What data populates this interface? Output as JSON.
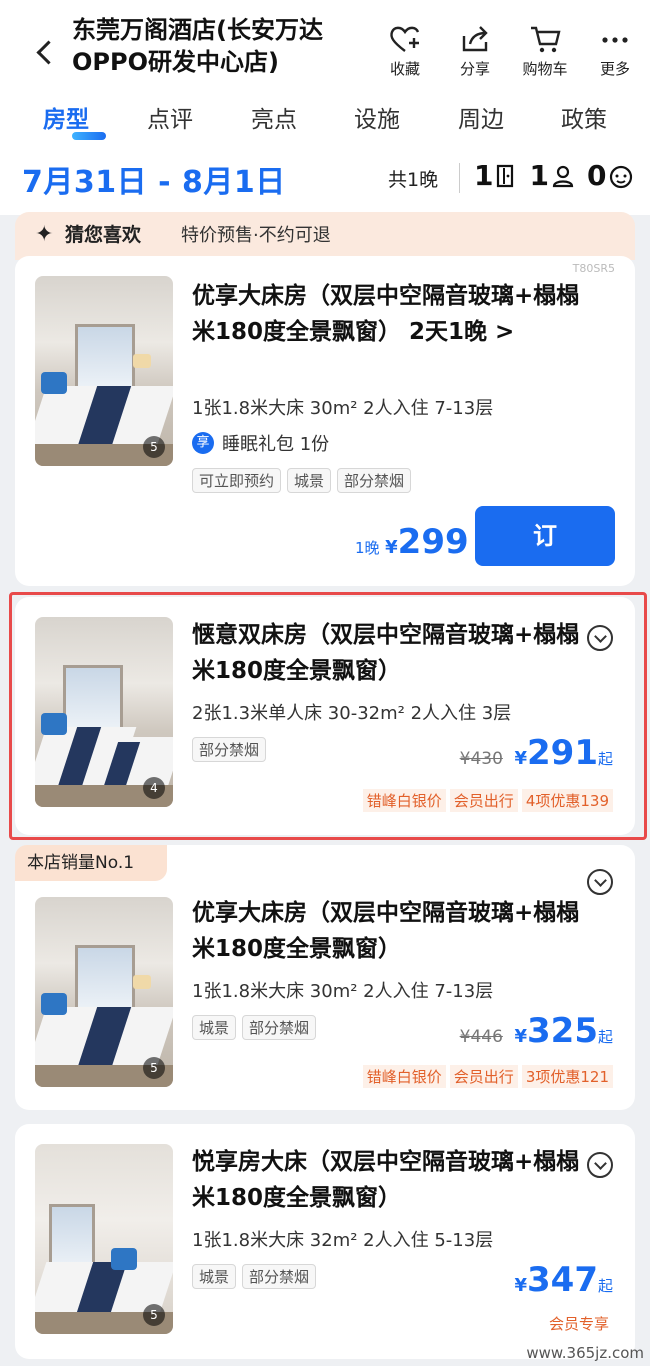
{
  "header": {
    "hotel_name": "东莞万阁酒店(长安万达OPPO研发中心店)",
    "actions": [
      {
        "label": "收藏",
        "icon": "heart-plus-icon"
      },
      {
        "label": "分享",
        "icon": "share-icon"
      },
      {
        "label": "购物车",
        "icon": "cart-icon"
      },
      {
        "label": "更多",
        "icon": "more-icon"
      }
    ]
  },
  "tabs": [
    "房型",
    "点评",
    "亮点",
    "设施",
    "周边",
    "政策"
  ],
  "active_tab": "房型",
  "dates": {
    "range": "7月31日 - 8月1日",
    "nights": "共1晚",
    "rooms": "1",
    "adults": "1",
    "children": "0"
  },
  "promo": {
    "title": "猜您喜欢",
    "subtitle": "特价预售·不约可退"
  },
  "rooms": [
    {
      "code": "T80SR5",
      "name": "优享大床房（双层中空隔音玻璃+榻榻米180度全景飘窗） 2天1晚 >",
      "spec": "1张1.8米大床 30m² 2人入住 7-13层",
      "perk_icon": "享",
      "perk": "睡眠礼包 1份",
      "tags": [
        "可立即预约",
        "城景",
        "部分禁烟"
      ],
      "price_prefix": "1晚",
      "currency": "¥",
      "price": "299",
      "book_label": "订",
      "photo_count": "5"
    },
    {
      "name": "惬意双床房（双层中空隔音玻璃+榻榻米180度全景飘窗）",
      "spec": "2张1.3米单人床 30-32m² 2人入住 3层",
      "tags": [
        "部分禁烟"
      ],
      "old_price": "¥430",
      "currency": "¥",
      "price": "291",
      "price_suffix": "起",
      "promos": [
        "错峰白银价",
        "会员出行",
        "4项优惠139"
      ],
      "photo_count": "4"
    },
    {
      "badge": "本店销量No.1",
      "name": "优享大床房（双层中空隔音玻璃+榻榻米180度全景飘窗）",
      "spec": "1张1.8米大床 30m² 2人入住 7-13层",
      "tags": [
        "城景",
        "部分禁烟"
      ],
      "old_price": "¥446",
      "currency": "¥",
      "price": "325",
      "price_suffix": "起",
      "promos": [
        "错峰白银价",
        "会员出行",
        "3项优惠121"
      ],
      "photo_count": "5"
    },
    {
      "name": "悦享房大床（双层中空隔音玻璃+榻榻米180度全景飘窗）",
      "spec": "1张1.8米大床 32m² 2人入住 5-13层",
      "tags": [
        "城景",
        "部分禁烟"
      ],
      "currency": "¥",
      "price": "347",
      "price_suffix": "起",
      "promos": [
        "会员专享"
      ],
      "photo_count": "5"
    }
  ],
  "watermark": "www.365jz.com",
  "colors": {
    "accent": "#1a6cf0",
    "promo_orange": "#e2602a",
    "highlight": "#e84a4a"
  }
}
